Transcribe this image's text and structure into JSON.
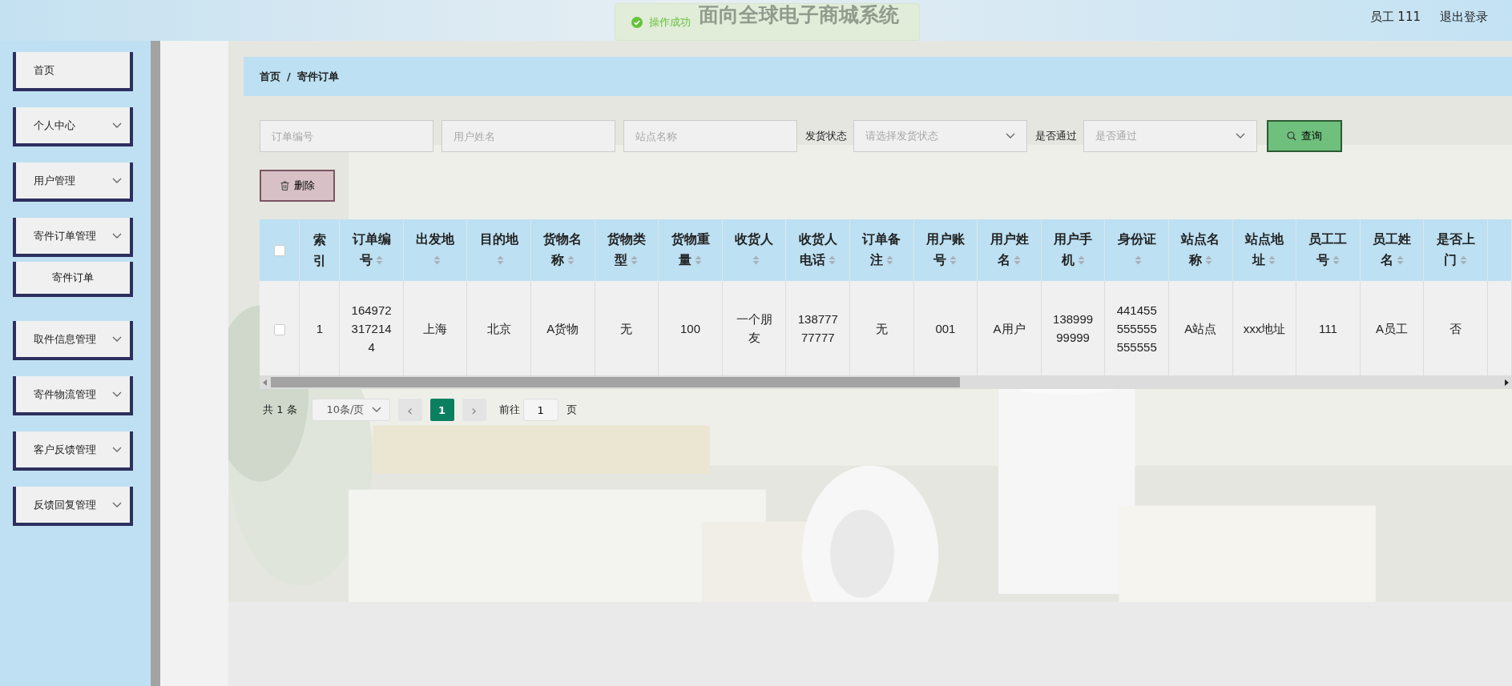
{
  "header": {
    "title": "面向全球电子商城系统",
    "toast": {
      "text": "操作成功",
      "kind": "success"
    },
    "user": "员工 111",
    "logout": "退出登录"
  },
  "sidebar": {
    "items": [
      {
        "label": "首页",
        "expandable": false
      },
      {
        "label": "个人中心",
        "expandable": true
      },
      {
        "label": "用户管理",
        "expandable": true
      },
      {
        "label": "寄件订单管理",
        "expandable": true,
        "children": [
          {
            "label": "寄件订单",
            "selected": true
          }
        ]
      },
      {
        "label": "取件信息管理",
        "expandable": true
      },
      {
        "label": "寄件物流管理",
        "expandable": true
      },
      {
        "label": "客户反馈管理",
        "expandable": true
      },
      {
        "label": "反馈回复管理",
        "expandable": true
      }
    ]
  },
  "breadcrumb": {
    "items": [
      "首页",
      "寄件订单"
    ],
    "separator": "/"
  },
  "filters": [
    {
      "kind": "input",
      "placeholder": "订单编号"
    },
    {
      "kind": "input",
      "placeholder": "用户姓名"
    },
    {
      "kind": "input",
      "placeholder": "站点名称"
    },
    {
      "kind": "select",
      "label": "发货状态",
      "placeholder": "请选择发货状态"
    },
    {
      "kind": "select",
      "label": "是否通过",
      "placeholder": "是否通过"
    }
  ],
  "search_button": "查询",
  "delete_button": "删除",
  "table": {
    "select_all": {
      "checked": false
    },
    "columns": [
      {
        "label": "索引",
        "sortable": false
      },
      {
        "label": "订单编号",
        "sortable": true
      },
      {
        "label": "出发地",
        "sortable": true
      },
      {
        "label": "目的地",
        "sortable": true
      },
      {
        "label": "货物名称",
        "sortable": true
      },
      {
        "label": "货物类型",
        "sortable": true
      },
      {
        "label": "货物重量",
        "sortable": true
      },
      {
        "label": "收货人",
        "sortable": true
      },
      {
        "label": "收货人电话",
        "sortable": true
      },
      {
        "label": "订单备注",
        "sortable": true
      },
      {
        "label": "用户账号",
        "sortable": true
      },
      {
        "label": "用户姓名",
        "sortable": true
      },
      {
        "label": "用户手机",
        "sortable": true
      },
      {
        "label": "身份证",
        "sortable": true
      },
      {
        "label": "站点名称",
        "sortable": true
      },
      {
        "label": "站点地址",
        "sortable": true
      },
      {
        "label": "员工工号",
        "sortable": true
      },
      {
        "label": "员工姓名",
        "sortable": true
      },
      {
        "label": "是否上门",
        "sortable": true
      }
    ],
    "rows": [
      {
        "checked": false,
        "cells": [
          "1",
          "1649723172144",
          "上海",
          "北京",
          "A货物",
          "无",
          "100",
          "一个朋友",
          "13877777777",
          "无",
          "001",
          "A用户",
          "13899999999",
          "441455555555555555",
          "A站点",
          "xxx地址",
          "111",
          "A员工",
          "否"
        ]
      }
    ]
  },
  "pagination": {
    "total": "共 1 条",
    "page_size": "10条/页",
    "prev": "‹",
    "pages": [
      {
        "label": "1",
        "selected": true
      }
    ],
    "next": "›",
    "goto_label": "前往",
    "goto_value": "1",
    "goto_suffix": "页"
  }
}
